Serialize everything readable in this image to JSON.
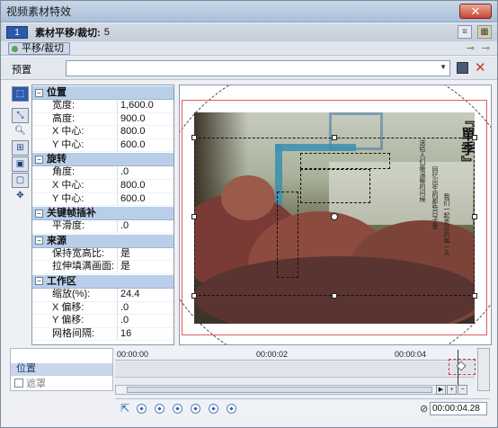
{
  "window": {
    "title": "视频素材特效",
    "close_glyph": "✕"
  },
  "header": {
    "badge": "1",
    "label": "素材平移/裁切:",
    "count": "5"
  },
  "chain": {
    "item": "平移/裁切"
  },
  "preset": {
    "label": "预置",
    "value": ""
  },
  "properties": {
    "sections": [
      {
        "name": "位置",
        "rows": [
          [
            "宽度:",
            "1,600.0"
          ],
          [
            "高度:",
            "900.0"
          ],
          [
            "X 中心:",
            "800.0"
          ],
          [
            "Y 中心:",
            "600.0"
          ]
        ]
      },
      {
        "name": "旋转",
        "rows": [
          [
            "角度:",
            ".0"
          ],
          [
            "X 中心:",
            "800.0"
          ],
          [
            "Y 中心:",
            "600.0"
          ]
        ]
      },
      {
        "name": "关键帧插补",
        "rows": [
          [
            "平滑度:",
            ".0"
          ]
        ]
      },
      {
        "name": "来源",
        "rows": [
          [
            "保持宽高比:",
            "是"
          ],
          [
            "拉伸填满画面:",
            "是"
          ]
        ]
      },
      {
        "name": "工作区",
        "rows": [
          [
            "缩放(%):",
            "24.4"
          ],
          [
            "X 偏移:",
            ".0"
          ],
          [
            "Y 偏移:",
            ".0"
          ],
          [
            "网格间隔:",
            "16"
          ]
        ]
      }
    ]
  },
  "preview": {
    "title_text": "『單季』",
    "sub_lines": [
      "送给人们最温暖的问候",
      "回忆出生的那些日子里",
      "我们一起走过的每一天"
    ]
  },
  "timeline": {
    "track_label": "位置",
    "mask_label": "遮罩",
    "ticks": [
      "00:00:00",
      "00:00:02",
      "00:00:04"
    ],
    "timecode": "00:00:04.28"
  },
  "colors": {
    "accent": "#2b5cad",
    "frame_red": "#e25a5a",
    "section_bg": "#b9cfe9"
  }
}
